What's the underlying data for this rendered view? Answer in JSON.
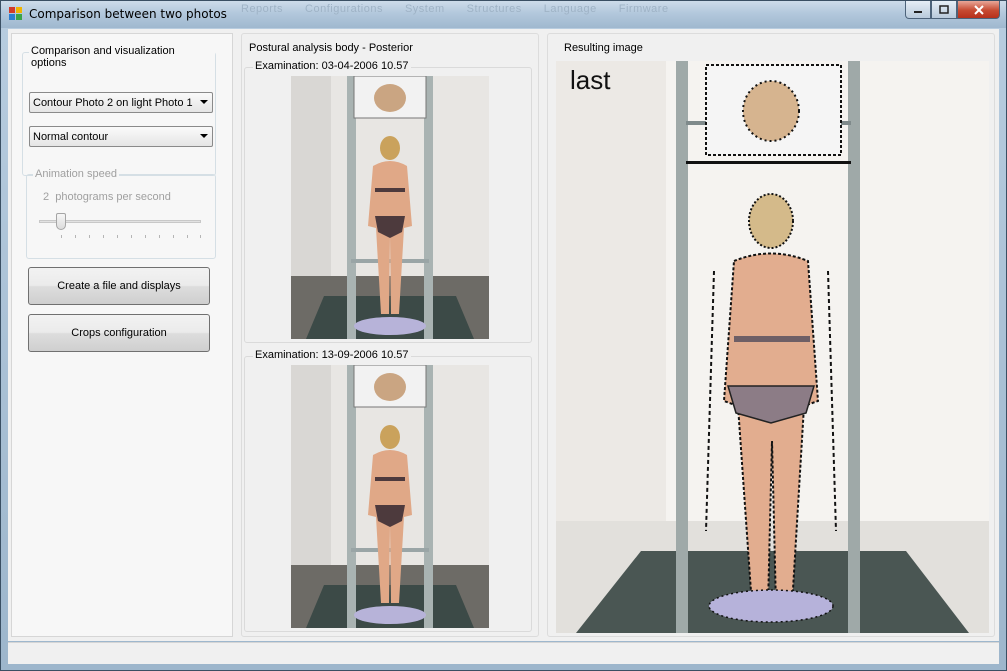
{
  "window": {
    "title": "Comparison between two photos",
    "background_menu": [
      "Reports",
      "Configurations",
      "System",
      "Structures",
      "Language",
      "Firmware"
    ]
  },
  "left": {
    "options_group_label": "Comparison and visualization options",
    "mode_combo_value": "Contour Photo 2 on light Photo 1",
    "contour_combo_value": "Normal contour",
    "animation_group_label": "Animation speed",
    "animation_speed_value": "2",
    "animation_speed_unit": "photograms per second",
    "create_button_label": "Create a file and displays",
    "crops_button_label": "Crops configuration"
  },
  "middle": {
    "title": "Postural analysis  body - Posterior",
    "exam1_label": "Examination: 03-04-2006 10.57",
    "exam2_label": "Examination: 13-09-2006 10.57"
  },
  "right": {
    "title": "Resulting image",
    "overlay_text": "last"
  },
  "colors": {
    "title_gradient_top": "#cddcea",
    "close_button": "#c64a31",
    "floor_dark": "#3c4a47",
    "wall": "#e9e6e2",
    "skin": "#e0a887"
  }
}
